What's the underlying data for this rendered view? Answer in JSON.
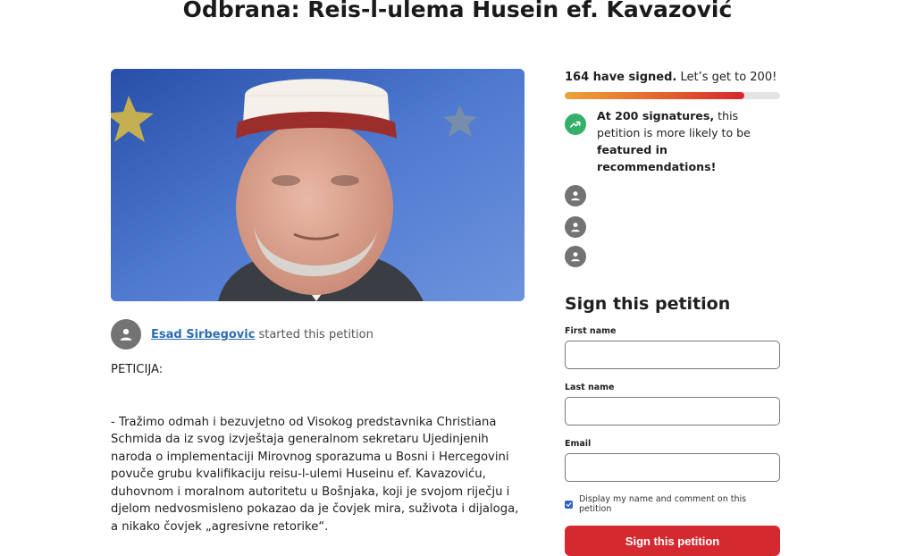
{
  "petition": {
    "title": "Odbrana: Reis-l-ulema Husein ef. Kavazović",
    "starter_name": "Esad Sirbegovic",
    "starter_suffix": "started this petition",
    "body": [
      "PETICIJA:",
      "- Tražimo odmah i bezuvjetno od Visokog predstavnika Christiana Schmida da iz svog izvještaja generalnom sekretaru Ujedinjenih naroda o implementaciji Mirovnog sporazuma u Bosni i Hercegovini povuče grubu kvalifikaciju reisu-l-ulemi Huseinu ef. Kavazoviću, duhovnom i moralnom autoritetu u Bošnjaka, koji je svojom riječju i djelom nedvosmisleno pokazao da je čovjek mira, suživota i dijaloga, a nikako čovjek „agresivne retorike“."
    ]
  },
  "progress": {
    "count_label": "164 have signed.",
    "goal_label": "Let’s get to 200!",
    "signed": 164,
    "goal": 200,
    "fraction": 0.835
  },
  "milestone": {
    "bold1": "At 200 signatures,",
    "mid": " this petition is more likely to be ",
    "bold2": "featured in recommendations!"
  },
  "form": {
    "heading": "Sign this petition",
    "first_name_label": "First name",
    "last_name_label": "Last name",
    "email_label": "Email",
    "display_checkbox_label": "Display my name and comment on this petition",
    "display_checked": true,
    "submit_label": "Sign this petition"
  },
  "icons": {
    "avatar": "person-icon",
    "milestone": "trending-up-icon",
    "checkbox": "checkmark-icon"
  },
  "colors": {
    "link": "#2d6db3",
    "button": "#d42a2f",
    "milestone_badge": "#35b06b",
    "checkbox": "#2f62c3"
  }
}
